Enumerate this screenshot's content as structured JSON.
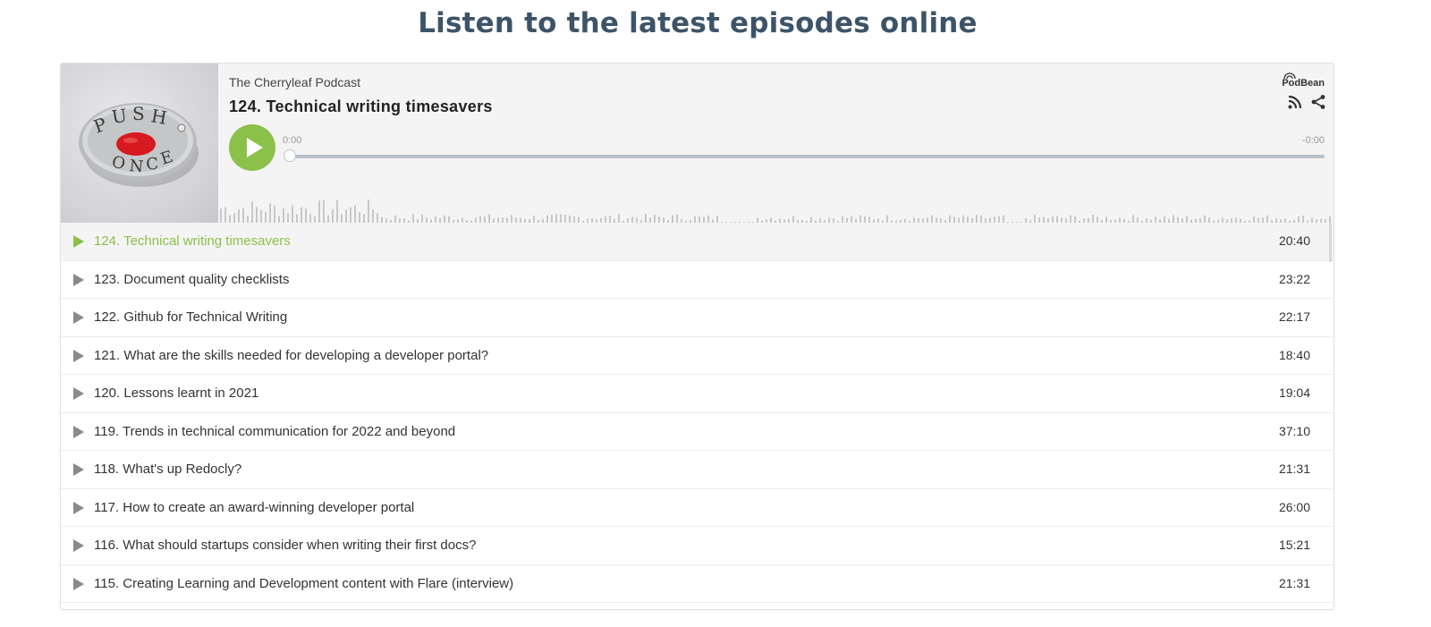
{
  "page": {
    "heading": "Listen to the latest episodes online"
  },
  "player": {
    "show_name": "The Cherryleaf Podcast",
    "current_episode": "124. Technical writing timesavers",
    "brand": "PodBean",
    "time_elapsed": "0:00",
    "time_remaining": "-0:00",
    "progress_fraction": 0,
    "accent_color": "#8bc04b",
    "icons": [
      "play-icon",
      "rss-icon",
      "share-icon",
      "podbean-logo"
    ]
  },
  "episodes": [
    {
      "title": "124. Technical writing timesavers",
      "duration": "20:40",
      "active": true
    },
    {
      "title": "123. Document quality checklists",
      "duration": "23:22"
    },
    {
      "title": "122. Github for Technical Writing",
      "duration": "22:17"
    },
    {
      "title": "121. What are the skills needed for developing a developer portal?",
      "duration": "18:40"
    },
    {
      "title": "120. Lessons learnt in 2021",
      "duration": "19:04"
    },
    {
      "title": "119. Trends in technical communication for 2022 and beyond",
      "duration": "37:10"
    },
    {
      "title": "118. What's up Redocly?",
      "duration": "21:31"
    },
    {
      "title": "117. How to create an award-winning developer portal",
      "duration": "26:00"
    },
    {
      "title": "116. What should startups consider when writing their first docs?",
      "duration": "15:21"
    },
    {
      "title": "115. Creating Learning and Development content with Flare (interview)",
      "duration": "21:31"
    }
  ]
}
